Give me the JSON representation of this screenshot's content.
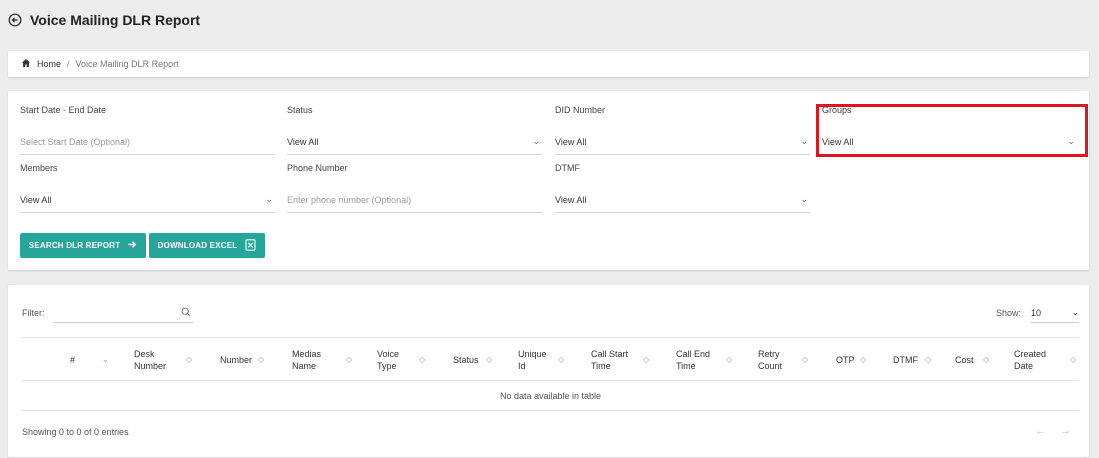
{
  "page": {
    "title": "Voice Mailing DLR Report"
  },
  "breadcrumb": {
    "home": "Home",
    "separator": "/",
    "current": "Voice Mailing DLR Report"
  },
  "filters": {
    "date_range": {
      "label": "Start Date - End Date",
      "placeholder": "Select Start Date (Optional)"
    },
    "status": {
      "label": "Status",
      "value": "View All"
    },
    "did_number": {
      "label": "DID Number",
      "value": "View All"
    },
    "groups": {
      "label": "Groups",
      "value": "View All"
    },
    "members": {
      "label": "Members",
      "value": "View All"
    },
    "phone_number": {
      "label": "Phone Number",
      "placeholder": "Enter phone number (Optional)"
    },
    "dtmf": {
      "label": "DTMF",
      "value": "View All"
    }
  },
  "buttons": {
    "search": "SEARCH DLR REPORT",
    "download": "DOWNLOAD EXCEL"
  },
  "table": {
    "filter_label": "Filter:",
    "show_label": "Show:",
    "page_size": "10",
    "columns": [
      "#",
      "Desk Number",
      "Number",
      "Medias Name",
      "Voice Type",
      "Status",
      "Unique Id",
      "Call Start Time",
      "Call End Time",
      "Retry Count",
      "OTP",
      "DTMF",
      "Cost",
      "Created Date"
    ],
    "empty_text": "No data available in table",
    "info": "Showing 0 to 0 of 0 entries",
    "prev": "←",
    "next": "→"
  },
  "colors": {
    "accent": "#26a69a",
    "highlight": "#e0141e"
  }
}
